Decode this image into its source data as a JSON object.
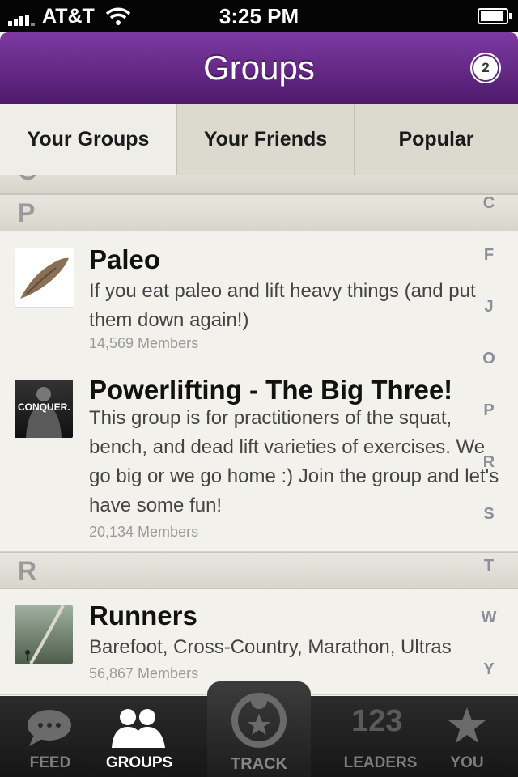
{
  "status_bar": {
    "carrier": "AT&T",
    "time": "3:25 PM"
  },
  "nav": {
    "title": "Groups",
    "badge_count": "2"
  },
  "tabs": [
    {
      "label": "Your Groups",
      "active": true
    },
    {
      "label": "Your Friends",
      "active": false
    },
    {
      "label": "Popular",
      "active": false
    }
  ],
  "sections": {
    "o_partial": "O",
    "p": "P",
    "r": "R"
  },
  "groups": [
    {
      "name": "Paleo",
      "description": "If you eat paleo and lift heavy things (and put them down again!)",
      "members": "14,569 Members"
    },
    {
      "name": "Powerlifting - The Big Three!",
      "description": "This group is for practitioners of the squat, bench, and dead lift varieties of exercises.  We go big or we go home :)  Join the group and let's have some fun!",
      "members": "20,134 Members",
      "thumb_text": "CONQUER."
    },
    {
      "name": "Runners",
      "description": "Barefoot, Cross-Country, Marathon, Ultras",
      "members": "56,867 Members"
    }
  ],
  "index_letters": [
    "C",
    "F",
    "J",
    "O",
    "P",
    "R",
    "S",
    "T",
    "W",
    "Y"
  ],
  "tab_bar": {
    "feed": "FEED",
    "groups": "GROUPS",
    "track": "TRACK",
    "leaders": "LEADERS",
    "leaders_icon_text": "123",
    "you": "YOU"
  },
  "colors": {
    "nav_top": "#7d3aa2",
    "nav_bottom": "#4e1a6c",
    "tab_active_label": "#ffffff"
  }
}
